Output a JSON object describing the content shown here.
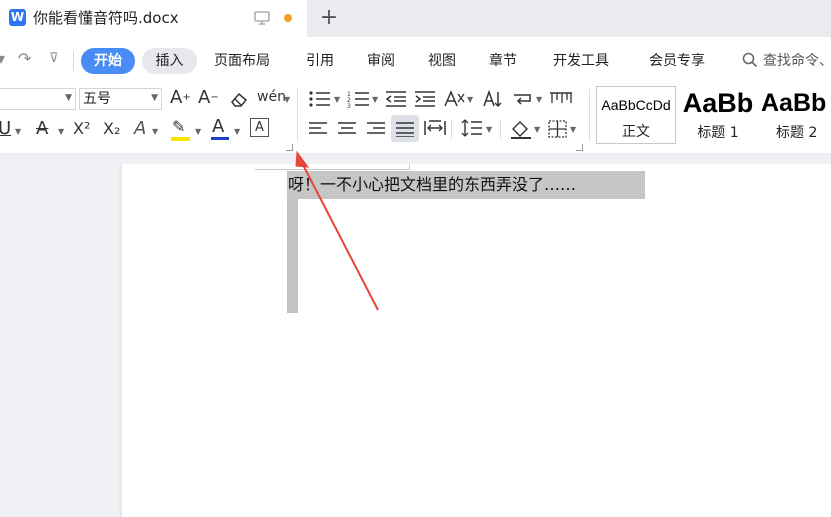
{
  "titlebar": {
    "doc_icon_letter": "W",
    "doc_title": "你能看懂音符吗.docx",
    "new_tab": "+"
  },
  "quick_access": {
    "redo": "↷",
    "more": "⊽"
  },
  "menu": {
    "start": "开始",
    "insert": "插入",
    "page_layout": "页面布局",
    "references": "引用",
    "review": "审阅",
    "view": "视图",
    "section": "章节",
    "developer": "开发工具",
    "member": "会员专享",
    "search": "查找命令、"
  },
  "ribbon": {
    "font_size": "五号",
    "grow_font": "A",
    "shrink_font": "A",
    "clear_format": "⌫",
    "phonetic": "wén",
    "underline": "U",
    "strike": "A",
    "superscript": "X²",
    "subscript": "X₂",
    "text_effect": "A",
    "highlight": "✎",
    "font_color": "A",
    "char_border": "A"
  },
  "styles": {
    "normal_preview": "AaBbCcDd",
    "normal_name": "正文",
    "heading1_preview": "AaBb",
    "heading1_name": "标题 1",
    "heading2_preview": "AaBb",
    "heading2_name": "标题 2"
  },
  "document": {
    "text": "呀！一不小心把文档里的东西弄没了……"
  },
  "colors": {
    "accent": "#4a8cf5",
    "highlight": "#f7e600",
    "font_color": "#1f3fd1",
    "arrow": "#e8443a",
    "unsaved_dot": "#f0a12a"
  }
}
